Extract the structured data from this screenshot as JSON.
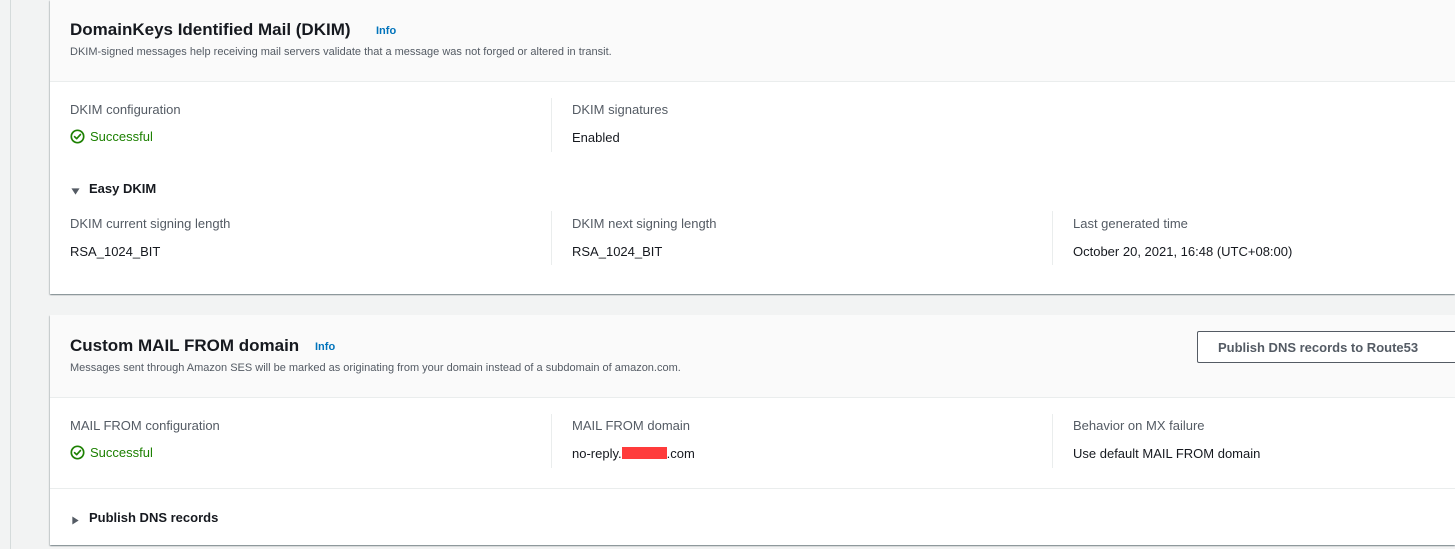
{
  "dkim": {
    "title": "DomainKeys Identified Mail (DKIM)",
    "info": "Info",
    "description": "DKIM-signed messages help receiving mail servers validate that a message was not forged or altered in transit.",
    "config_label": "DKIM configuration",
    "config_value": "Successful",
    "signatures_label": "DKIM signatures",
    "signatures_value": "Enabled",
    "easy_dkim_label": "Easy DKIM",
    "current_length_label": "DKIM current signing length",
    "current_length_value": "RSA_1024_BIT",
    "next_length_label": "DKIM next signing length",
    "next_length_value": "RSA_1024_BIT",
    "last_generated_label": "Last generated time",
    "last_generated_value": "October 20, 2021, 16:48 (UTC+08:00)"
  },
  "mail_from": {
    "title": "Custom MAIL FROM domain",
    "info": "Info",
    "description": "Messages sent through Amazon SES will be marked as originating from your domain instead of a subdomain of amazon.com.",
    "publish_button": "Publish DNS records to Route53",
    "config_label": "MAIL FROM configuration",
    "config_value": "Successful",
    "domain_label": "MAIL FROM domain",
    "domain_prefix": "no-reply.",
    "domain_suffix": ".com",
    "behavior_label": "Behavior on MX failure",
    "behavior_value": "Use default MAIL FROM domain",
    "publish_dns_label": "Publish DNS records"
  },
  "colors": {
    "success": "#1d8102",
    "link": "#0073bb",
    "redaction": "#ff3b3b"
  },
  "icons": {
    "status": "check-circle-icon",
    "expanded": "caret-down-icon",
    "collapsed": "caret-right-icon"
  }
}
